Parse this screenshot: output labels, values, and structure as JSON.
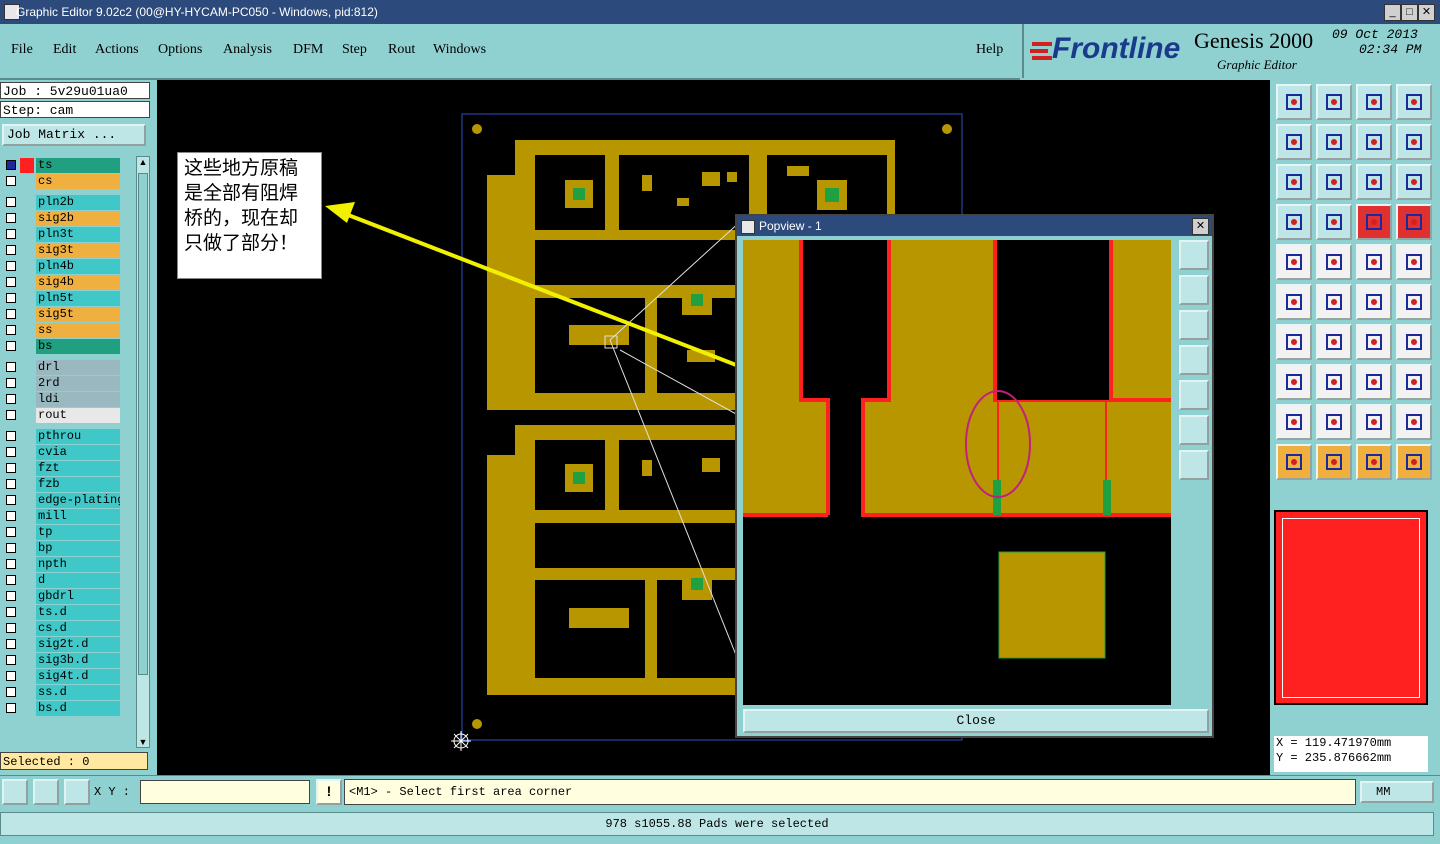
{
  "window": {
    "title": "Graphic Editor 9.02c2 (00@HY-HYCAM-PC050 - Windows, pid:812)"
  },
  "menu": {
    "items": [
      "File",
      "Edit",
      "Actions",
      "Options",
      "Analysis",
      "DFM",
      "Step",
      "Rout",
      "Windows"
    ],
    "help": "Help"
  },
  "brand": {
    "logo": "Frontline",
    "product": "Genesis 2000",
    "subtitle": "Graphic Editor",
    "date": "09 Oct 2013",
    "time": "02:34 PM"
  },
  "job": {
    "job_line": "Job : 5v29u01ua0",
    "step_line": "Step: cam",
    "matrix_button": "Job Matrix ..."
  },
  "layers": [
    {
      "name": "ts",
      "color": "#20a080",
      "active": true
    },
    {
      "name": "cs",
      "color": "#f0b040"
    },
    {
      "name": "pln2b",
      "color": "#40c8c8"
    },
    {
      "name": "sig2b",
      "color": "#f0b040"
    },
    {
      "name": "pln3t",
      "color": "#40c8c8"
    },
    {
      "name": "sig3t",
      "color": "#f0b040"
    },
    {
      "name": "pln4b",
      "color": "#40c8c8"
    },
    {
      "name": "sig4b",
      "color": "#f0b040"
    },
    {
      "name": "pln5t",
      "color": "#40c8c8"
    },
    {
      "name": "sig5t",
      "color": "#f0b040"
    },
    {
      "name": "ss",
      "color": "#f0b040"
    },
    {
      "name": "bs",
      "color": "#20a080"
    },
    {
      "name": "drl",
      "color": "#9ab8c0"
    },
    {
      "name": "2rd",
      "color": "#9ab8c0"
    },
    {
      "name": "ldi",
      "color": "#9ab8c0"
    },
    {
      "name": "rout",
      "color": "#e8e8e8"
    },
    {
      "name": "pthrou",
      "color": "#40c8c8"
    },
    {
      "name": "cvia",
      "color": "#40c8c8"
    },
    {
      "name": "fzt",
      "color": "#40c8c8"
    },
    {
      "name": "fzb",
      "color": "#40c8c8"
    },
    {
      "name": "edge-plating",
      "color": "#40c8c8"
    },
    {
      "name": "mill",
      "color": "#40c8c8"
    },
    {
      "name": "tp",
      "color": "#40c8c8"
    },
    {
      "name": "bp",
      "color": "#40c8c8"
    },
    {
      "name": "npth",
      "color": "#40c8c8"
    },
    {
      "name": "d",
      "color": "#40c8c8"
    },
    {
      "name": "gbdrl",
      "color": "#40c8c8"
    },
    {
      "name": "ts.d",
      "color": "#40c8c8"
    },
    {
      "name": "cs.d",
      "color": "#40c8c8"
    },
    {
      "name": "sig2t.d",
      "color": "#40c8c8"
    },
    {
      "name": "sig3b.d",
      "color": "#40c8c8"
    },
    {
      "name": "sig4t.d",
      "color": "#40c8c8"
    },
    {
      "name": "ss.d",
      "color": "#40c8c8"
    },
    {
      "name": "bs.d",
      "color": "#40c8c8"
    }
  ],
  "selected": "Selected : 0",
  "annotation": {
    "text": "这些地方原稿是全部有阻焊桥的，现在却只做了部分！"
  },
  "popview": {
    "title": "Popview - 1",
    "close": "Close"
  },
  "coords": {
    "x": "X = 119.471970mm",
    "y": "Y = 235.876662mm"
  },
  "bottom": {
    "xy_label": "X Y :",
    "message": "<M1> - Select first area corner",
    "units": "MM",
    "status": "978 s1055.88 Pads were selected"
  },
  "colors": {
    "copper": "#b89600",
    "soldermask_red": "#ff2020",
    "panel_bg": "#8fd0d0",
    "arrow": "#f0f000"
  }
}
